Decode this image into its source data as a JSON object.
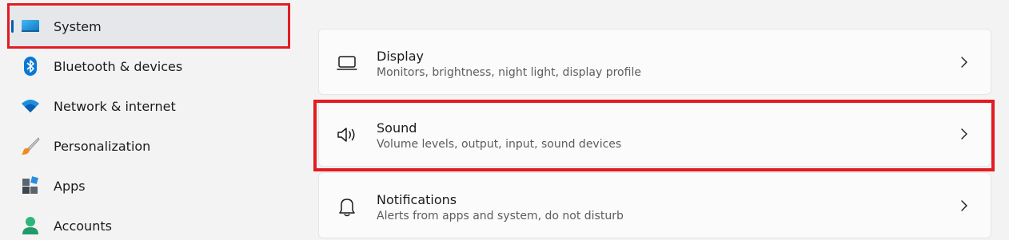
{
  "sidebar": {
    "items": [
      {
        "label": "System",
        "icon": "system-display-icon",
        "selected": true
      },
      {
        "label": "Bluetooth & devices",
        "icon": "bluetooth-icon"
      },
      {
        "label": "Network & internet",
        "icon": "wifi-icon"
      },
      {
        "label": "Personalization",
        "icon": "paintbrush-icon"
      },
      {
        "label": "Apps",
        "icon": "apps-icon"
      },
      {
        "label": "Accounts",
        "icon": "person-icon"
      }
    ]
  },
  "main": {
    "cards": [
      {
        "title": "Display",
        "subtitle": "Monitors, brightness, night light, display profile",
        "icon": "monitor-icon"
      },
      {
        "title": "Sound",
        "subtitle": "Volume levels, output, input, sound devices",
        "icon": "speaker-icon"
      },
      {
        "title": "Notifications",
        "subtitle": "Alerts from apps and system, do not disturb",
        "icon": "bell-icon"
      }
    ]
  },
  "colors": {
    "accent": "#005fb8",
    "highlight": "#e31b23",
    "background": "#f3f3f3",
    "card": "#fbfbfb"
  }
}
